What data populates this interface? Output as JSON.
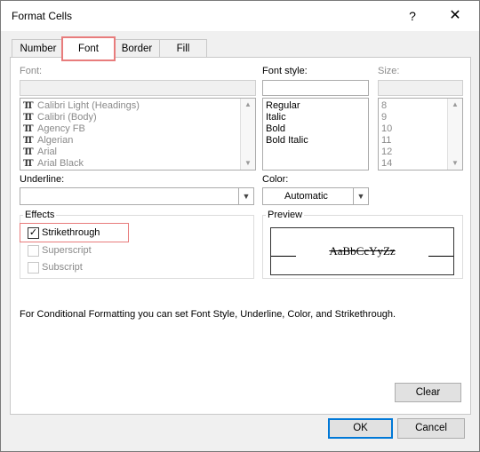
{
  "window": {
    "title": "Format Cells",
    "help": "?",
    "close": "✕"
  },
  "tabs": [
    {
      "label": "Number",
      "active": false
    },
    {
      "label": "Font",
      "active": true
    },
    {
      "label": "Border",
      "active": false
    },
    {
      "label": "Fill",
      "active": false
    }
  ],
  "font": {
    "label": "Font:",
    "value": "",
    "items": [
      "Calibri Light (Headings)",
      "Calibri (Body)",
      "Agency FB",
      "Algerian",
      "Arial",
      "Arial Black"
    ]
  },
  "font_style": {
    "label": "Font style:",
    "value": "",
    "items": [
      "Regular",
      "Italic",
      "Bold",
      "Bold Italic"
    ]
  },
  "size": {
    "label": "Size:",
    "value": "",
    "items": [
      "8",
      "9",
      "10",
      "11",
      "12",
      "14"
    ]
  },
  "underline": {
    "label": "Underline:",
    "value": ""
  },
  "color": {
    "label": "Color:",
    "value": "Automatic"
  },
  "effects": {
    "label": "Effects",
    "strikethrough": {
      "label": "Strikethrough",
      "checked": true
    },
    "superscript": {
      "label": "Superscript",
      "checked": false
    },
    "subscript": {
      "label": "Subscript",
      "checked": false
    }
  },
  "preview": {
    "label": "Preview",
    "sample": "AaBbCcYyZz"
  },
  "info_text": "For Conditional Formatting you can set Font Style, Underline, Color, and Strikethrough.",
  "buttons": {
    "clear": "Clear",
    "ok": "OK",
    "cancel": "Cancel"
  },
  "colors": {
    "highlight": "#e87c7c",
    "default_button": "#0078d7"
  }
}
